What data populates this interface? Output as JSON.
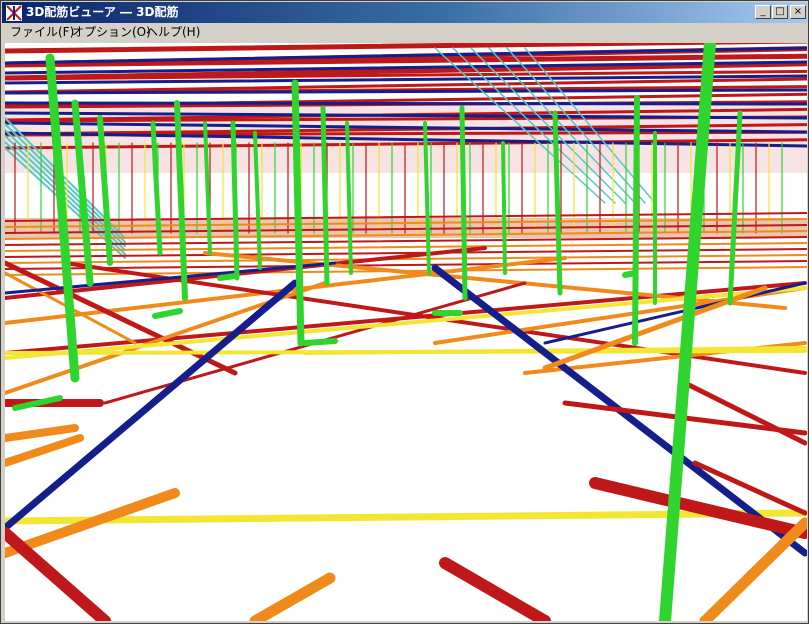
{
  "window": {
    "title": "3D配筋ビューア ― 3D配筋",
    "controls": {
      "minimize": "_",
      "maximize": "□",
      "close": "×"
    }
  },
  "menu": [
    {
      "label": "ファイル(F)"
    },
    {
      "label": "オプション(O)"
    },
    {
      "label": "ヘルプ(H)"
    }
  ],
  "viewport": {
    "content": "3d-rebar-model",
    "colors": {
      "column_rebar": "#2fd42f",
      "beam_x": "#c01818",
      "beam_y": "#141e8c",
      "slab_bar": "#f08a1a",
      "tie_bar": "#f2e632",
      "stirrup": "#55c8c8"
    }
  }
}
